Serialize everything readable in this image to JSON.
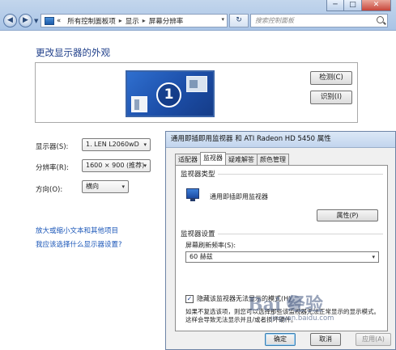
{
  "window": {
    "minimize_glyph": "─",
    "maximize_glyph": "□",
    "close_glyph": "✕"
  },
  "nav": {
    "back_glyph": "◀",
    "forward_glyph": "▶",
    "history_glyph": "▼",
    "breadcrumbs": [
      "«",
      "所有控制面板项",
      "显示",
      "屏幕分辨率"
    ],
    "separator": "▸",
    "address_dropdown_glyph": "▾",
    "refresh_glyph": "↻",
    "search_placeholder": "搜索控制面板"
  },
  "page": {
    "title": "更改显示器的外观",
    "monitor_number": "1",
    "detect_button": "检测(C)",
    "identify_button": "识别(I)",
    "display_label": "显示器(S):",
    "display_value": "1. LEN L2060wD",
    "resolution_label": "分辨率(R):",
    "resolution_value": "1600 × 900 (推荐)",
    "orientation_label": "方向(O):",
    "orientation_value": "横向",
    "combo_arrow": "▾",
    "link_text_size": "放大或缩小文本和其他项目",
    "link_which_settings": "我应该选择什么显示器设置?"
  },
  "dialog": {
    "title": "通用即插即用监视器 和 ATI Radeon HD 5450 属性",
    "tabs": [
      "适配器",
      "监视器",
      "疑难解答",
      "颜色管理"
    ],
    "monitor_type_group": "监视器类型",
    "monitor_type_name": "通用即插即用监视器",
    "properties_button": "属性(P)",
    "monitor_settings_group": "监视器设置",
    "refresh_rate_label": "屏幕刷新频率(S):",
    "refresh_rate_value": "60 赫兹",
    "hide_modes_label": "隐藏该监视器无法显示的模式(H)",
    "hide_modes_checked": "✓",
    "note": "如果不复选该项，则您可以选择那些该监视器无法正常显示的显示模式。这样会导致无法显示并且/或者损坏硬件。",
    "ok_button": "确定",
    "cancel_button": "取消",
    "apply_button": "应用(A)"
  },
  "watermark": {
    "logo_text": "Bai   经验",
    "url": "jingyan.baidu.com"
  }
}
